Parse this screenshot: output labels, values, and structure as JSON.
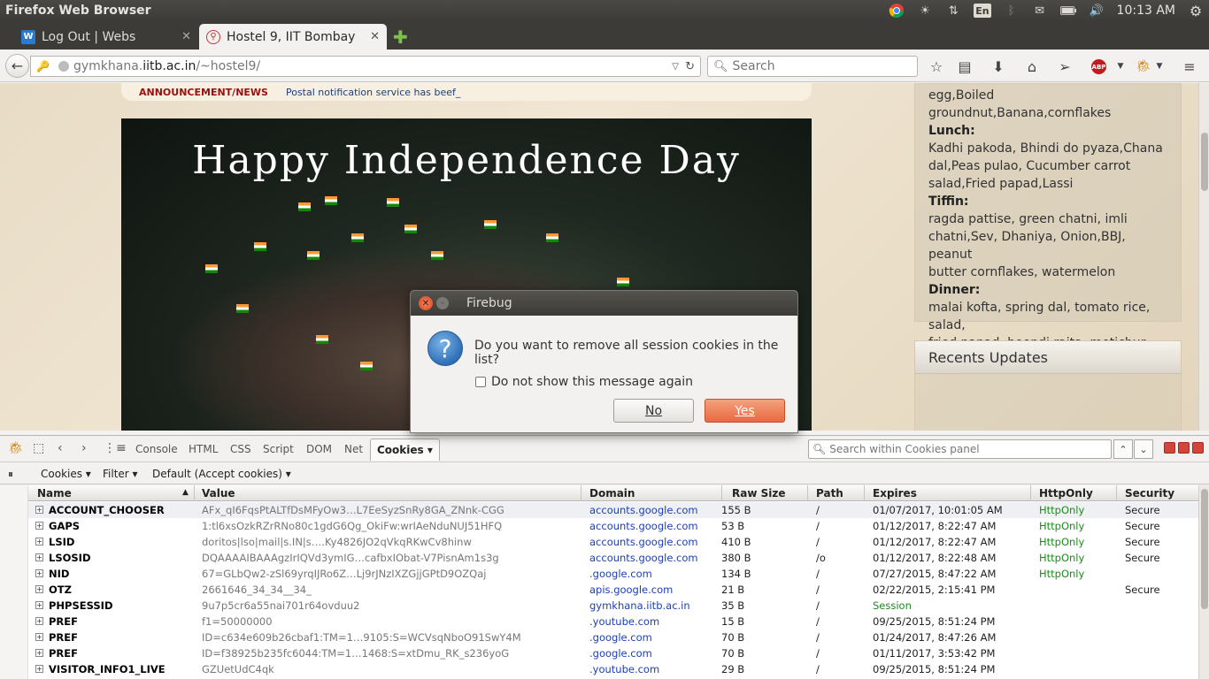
{
  "topbar": {
    "title": "Firefox Web Browser",
    "lang": "En",
    "time": "10:13 AM"
  },
  "tabs": [
    {
      "label": "Log Out | Webs",
      "icon": "w-favicon",
      "active": false
    },
    {
      "label": "Hostel 9, IIT Bombay",
      "icon": "map-pin-favicon",
      "active": true
    }
  ],
  "nav": {
    "url_prefix": "gymkhana.",
    "url_domain": "iitb.ac.in",
    "url_path": "/~hostel9/",
    "search_placeholder": "Search"
  },
  "page": {
    "announcement_label": "ANNOUNCEMENT/NEWS",
    "announcement_text": "Postal notification service has beef_",
    "banner_title": "Happy Independence Day",
    "menu": {
      "breakfast_tail": "egg,Boiled groundnut,Banana,cornflakes",
      "lunch_label": "Lunch:",
      "lunch_1": "Kadhi pakoda, Bhindi do pyaza,Chana",
      "lunch_2": "dal,Peas pulao, Cucumber carrot",
      "lunch_3": "salad,Fried papad,Lassi",
      "tiffin_label": "Tiffin:",
      "tiffin_1": "ragda pattise, green chatni, imli",
      "tiffin_2": "chatni,Sev, Dhaniya, Onion,BBJ, peanut",
      "tiffin_3": "butter cornflakes, watermelon",
      "dinner_label": "Dinner:",
      "dinner_1": "malai kofta, spring dal, tomato rice, salad,",
      "dinner_2": "fried papad, boondi raita, motichur laddoo"
    },
    "updates_title": "Recents Updates"
  },
  "dialog": {
    "title": "Firebug",
    "message": "Do you want to remove all session cookies in the list?",
    "checkbox_label": "Do not show this message again",
    "no_label": "No",
    "yes_label": "Yes"
  },
  "firebug": {
    "tabs": [
      "Console",
      "HTML",
      "CSS",
      "Script",
      "DOM",
      "Net"
    ],
    "active_tab": "Cookies",
    "search_placeholder": "Search within Cookies panel",
    "sub": {
      "cookies": "Cookies",
      "filter": "Filter",
      "default": "Default (Accept cookies)"
    },
    "columns": [
      "Name",
      "Value",
      "Domain",
      "Raw Size",
      "Path",
      "Expires",
      "HttpOnly",
      "Security"
    ],
    "rows": [
      {
        "name": "ACCOUNT_CHOOSER",
        "value": "AFx_qI6FqsPtALTfDsMFyOw3…L7EeSyzSnRy8GA_ZNnk-CGG",
        "domain": "accounts.google.com",
        "size": "155 B",
        "path": "/",
        "expires": "01/07/2017, 10:01:05 AM",
        "httponly": "HttpOnly",
        "security": "Secure"
      },
      {
        "name": "GAPS",
        "value": "1:tl6xsOzkRZrRNo80c1gdG6Qg_OkiFw:wrIAeNduNUJ51HFQ",
        "domain": "accounts.google.com",
        "size": "53 B",
        "path": "/",
        "expires": "01/12/2017, 8:22:47 AM",
        "httponly": "HttpOnly",
        "security": "Secure"
      },
      {
        "name": "LSID",
        "value": "doritos|lso|mail|s.IN|s….Ky4826JO2qVkqRKwCv8hinw",
        "domain": "accounts.google.com",
        "size": "410 B",
        "path": "/",
        "expires": "01/12/2017, 8:22:47 AM",
        "httponly": "HttpOnly",
        "security": "Secure"
      },
      {
        "name": "LSOSID",
        "value": "DQAAAAIBAAAgzIrIQVd3ymIG…cafbxIObat-V7PisnAm1s3g",
        "domain": "accounts.google.com",
        "size": "380 B",
        "path": "/o",
        "expires": "01/12/2017, 8:22:48 AM",
        "httponly": "HttpOnly",
        "security": "Secure"
      },
      {
        "name": "NID",
        "value": "67=GLbQw2-zSl69yrqIJRo6Z…Lj9rJNzIXZGjjGPtD9OZQaj",
        "domain": ".google.com",
        "size": "134 B",
        "path": "/",
        "expires": "07/27/2015, 8:47:22 AM",
        "httponly": "HttpOnly",
        "security": ""
      },
      {
        "name": "OTZ",
        "value": "2661646_34_34__34_",
        "domain": "apis.google.com",
        "size": "21 B",
        "path": "/",
        "expires": "02/22/2015, 2:15:41 PM",
        "httponly": "",
        "security": "Secure"
      },
      {
        "name": "PHPSESSID",
        "value": "9u7p5cr6a55nai701r64ovduu2",
        "domain": "gymkhana.iitb.ac.in",
        "size": "35 B",
        "path": "/",
        "expires": "Session",
        "httponly": "",
        "security": ""
      },
      {
        "name": "PREF",
        "value": "f1=50000000",
        "domain": ".youtube.com",
        "size": "15 B",
        "path": "/",
        "expires": "09/25/2015, 8:51:24 PM",
        "httponly": "",
        "security": ""
      },
      {
        "name": "PREF",
        "value": "ID=c634e609b26cbaf1:TM=1…9105:S=WCVsqNboO91SwY4M",
        "domain": ".google.com",
        "size": "70 B",
        "path": "/",
        "expires": "01/24/2017, 8:47:26 AM",
        "httponly": "",
        "security": ""
      },
      {
        "name": "PREF",
        "value": "ID=f38925b235fc6044:TM=1…1468:S=xtDmu_RK_s236yoG",
        "domain": ".google.com",
        "size": "70 B",
        "path": "/",
        "expires": "01/11/2017, 3:53:42 PM",
        "httponly": "",
        "security": ""
      },
      {
        "name": "VISITOR_INFO1_LIVE",
        "value": "GZUetUdC4qk",
        "domain": ".youtube.com",
        "size": "29 B",
        "path": "/",
        "expires": "09/25/2015, 8:51:24 PM",
        "httponly": "",
        "security": ""
      }
    ]
  },
  "colors": {
    "accent": "#e86a3e",
    "domain_link": "#1b3fb8",
    "httponly": "#1d8a1d"
  }
}
